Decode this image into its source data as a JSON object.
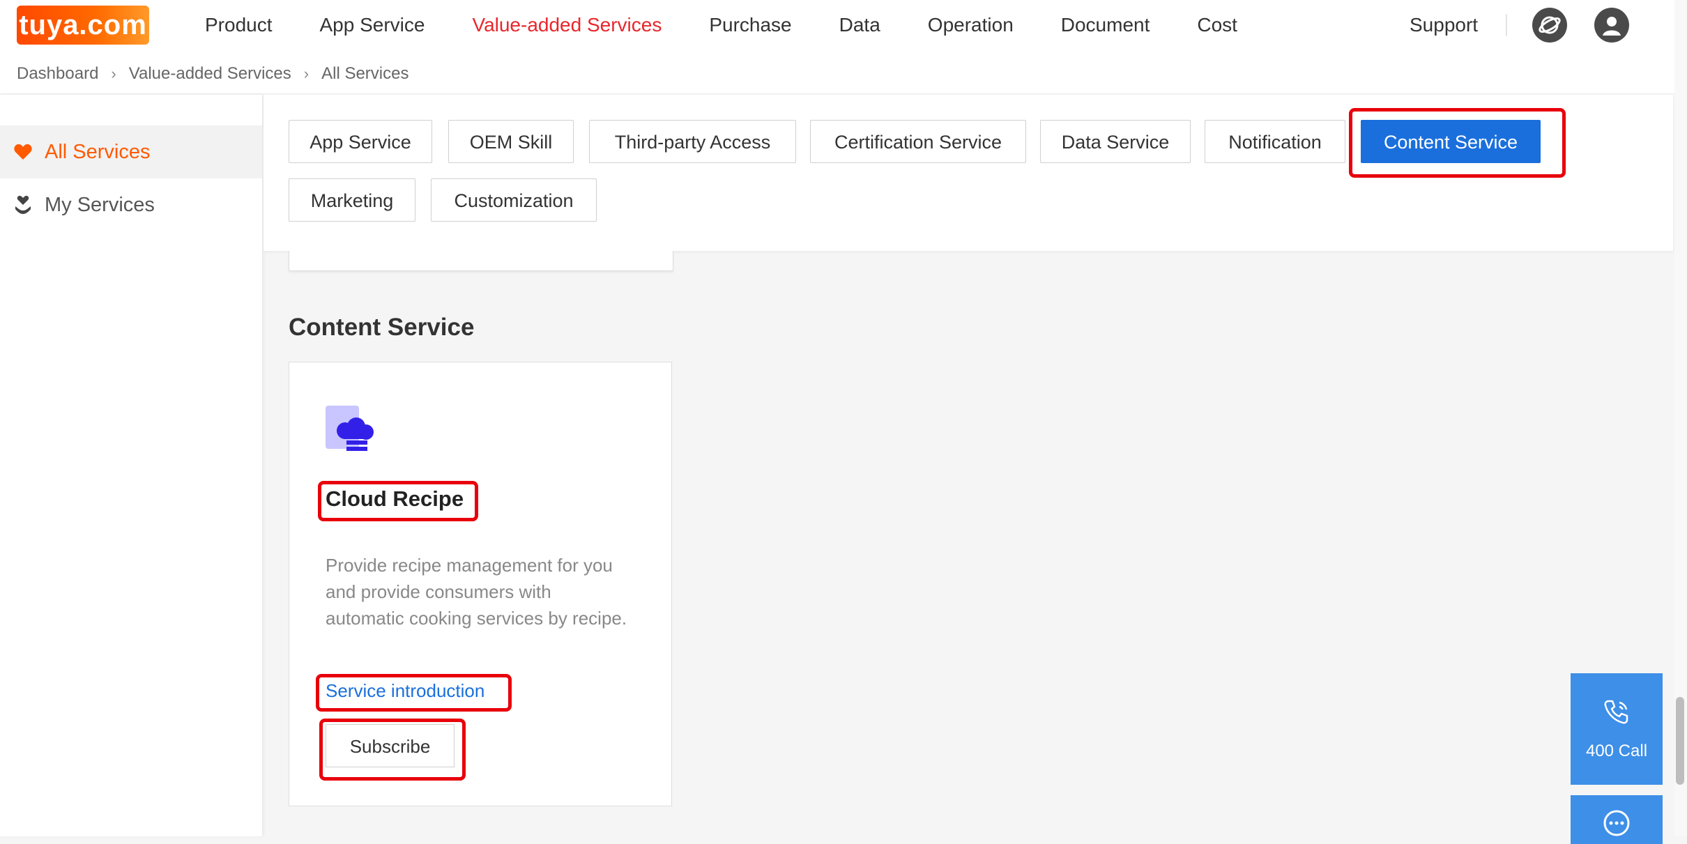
{
  "nav": {
    "logo": "tuya.com",
    "menu": [
      {
        "label": "Product",
        "active": false
      },
      {
        "label": "App Service",
        "active": false
      },
      {
        "label": "Value-added Services",
        "active": true
      },
      {
        "label": "Purchase",
        "active": false
      },
      {
        "label": "Data",
        "active": false
      },
      {
        "label": "Operation",
        "active": false
      },
      {
        "label": "Document",
        "active": false
      },
      {
        "label": "Cost",
        "active": false
      }
    ],
    "support": "Support",
    "accent_color": "#e8262c"
  },
  "breadcrumb": [
    "Dashboard",
    "Value-added Services",
    "All Services"
  ],
  "sidebar": {
    "items": [
      {
        "label": "All Services",
        "icon": "heart-icon",
        "active": true
      },
      {
        "label": "My Services",
        "icon": "hand-heart-icon",
        "active": false
      }
    ],
    "accent_color": "#ff5a00"
  },
  "filters": {
    "chips": [
      {
        "label": "App Service"
      },
      {
        "label": "OEM Skill"
      },
      {
        "label": "Third-party Access"
      },
      {
        "label": "Certification Service"
      },
      {
        "label": "Data Service"
      },
      {
        "label": "Notification"
      },
      {
        "label": "Content Service",
        "active": true
      },
      {
        "label": "Marketing"
      },
      {
        "label": "Customization"
      }
    ],
    "active_color": "#1a6fdc"
  },
  "section": {
    "title": "Content Service",
    "card": {
      "icon": "chef-hat-icon",
      "title": "Cloud Recipe",
      "description": "Provide recipe management for you and provide consumers with automatic cooking services by recipe.",
      "link": "Service introduction",
      "button": "Subscribe"
    }
  },
  "float": {
    "call_label": "400 Call",
    "call_icon": "phone-icon",
    "chat_icon": "chat-icon"
  }
}
